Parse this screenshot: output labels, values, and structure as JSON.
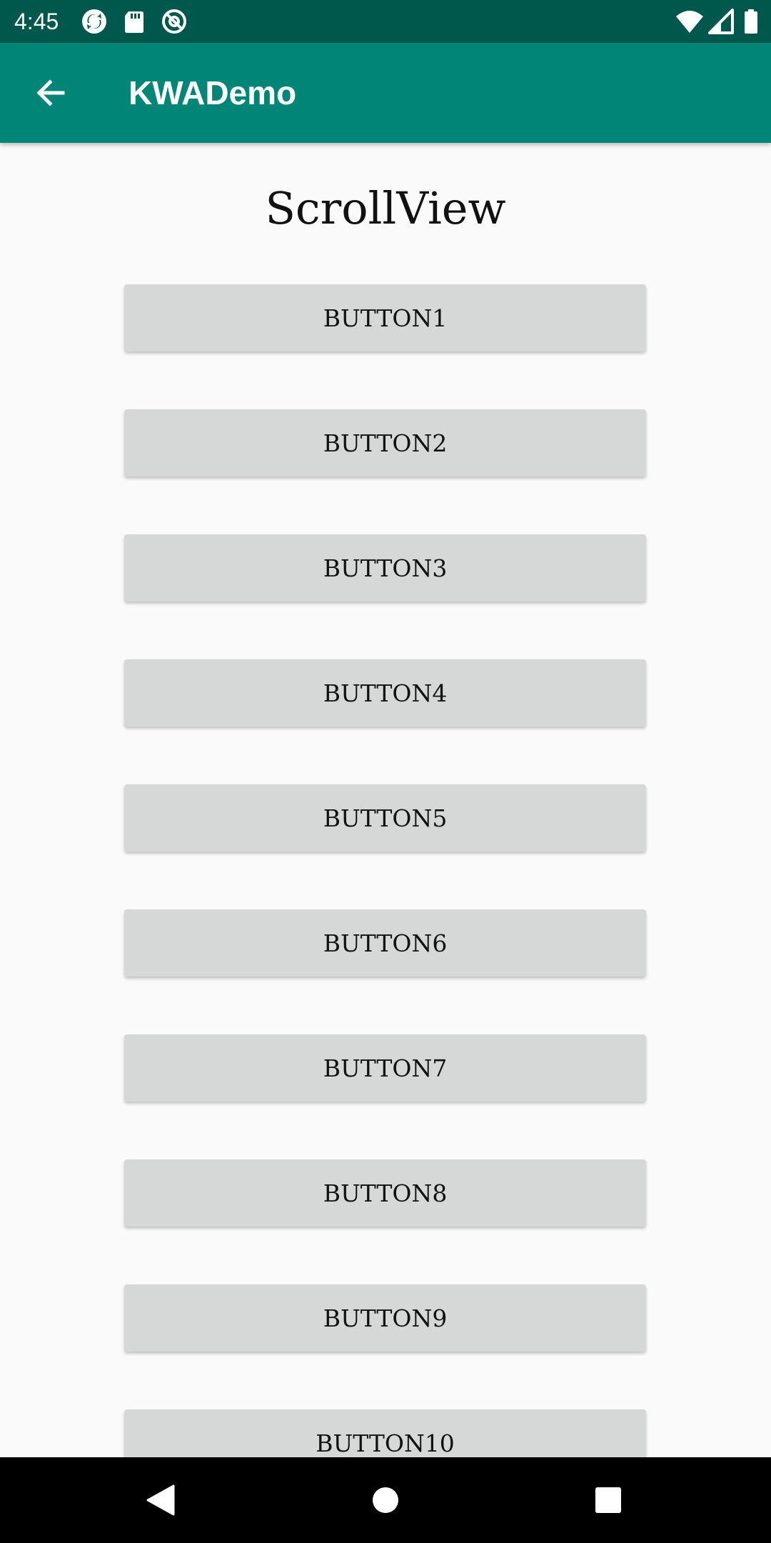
{
  "status_bar": {
    "time": "4:45",
    "left_icons": [
      "sync-icon",
      "sd-card-icon",
      "at-sign-icon"
    ],
    "right_icons": [
      "wifi-icon",
      "cellular-signal-icon",
      "battery-icon"
    ]
  },
  "app_bar": {
    "title": "KWADemo",
    "back_icon": "arrow-back-icon"
  },
  "page": {
    "title": "ScrollView",
    "buttons": [
      "BUTTON1",
      "BUTTON2",
      "BUTTON3",
      "BUTTON4",
      "BUTTON5",
      "BUTTON6",
      "BUTTON7",
      "BUTTON8",
      "BUTTON9",
      "BUTTON10"
    ]
  },
  "nav_bar": {
    "icons": [
      "back-triangle-icon",
      "home-circle-icon",
      "recents-square-icon"
    ]
  },
  "colors": {
    "status_bar": "#00574b",
    "app_bar": "#008577",
    "background": "#fafafa",
    "button": "#d6d7d7"
  }
}
